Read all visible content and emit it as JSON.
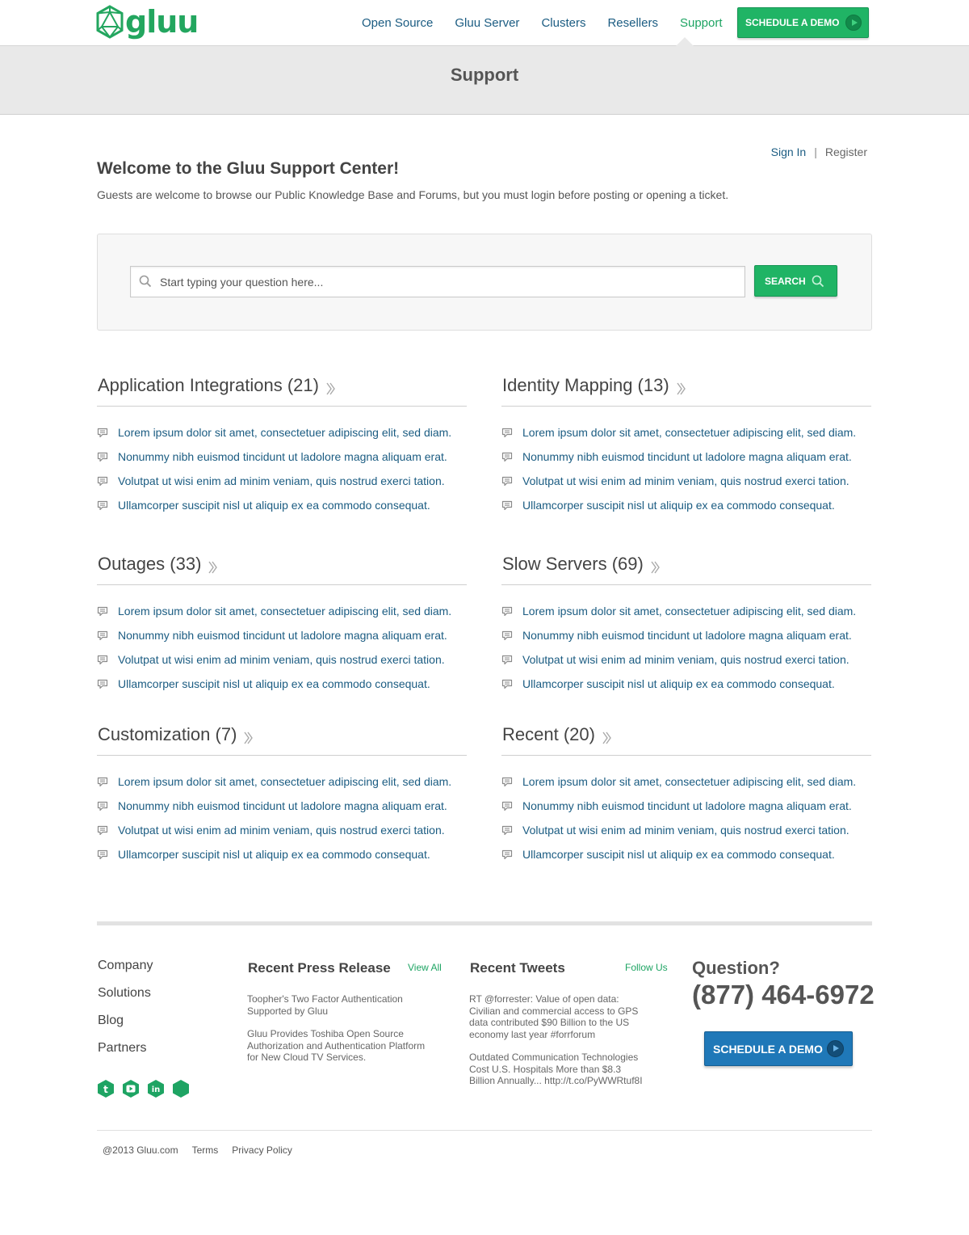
{
  "brand": {
    "name": "gluu",
    "color": "#23a65f",
    "icon": "gluu-logo-icon"
  },
  "nav": {
    "items": [
      "Open Source",
      "Gluu Server",
      "Clusters",
      "Resellers",
      "Support"
    ],
    "active": "Support",
    "demo_label": "SCHEDULE A DEMO",
    "demo_icon": "play-arrow-icon"
  },
  "page": {
    "title": "Support"
  },
  "auth": {
    "signin": "Sign In",
    "separator": "|",
    "register": "Register"
  },
  "welcome": {
    "title": "Welcome to the Gluu Support Center!",
    "subtitle": "Guests are welcome to browse our Public Knowledge Base and Forums, but you must login before posting or opening a ticket."
  },
  "search": {
    "placeholder": "Start typing your question here...",
    "button": "SEARCH",
    "icon": "search-icon"
  },
  "categories": [
    {
      "title": "Application Integrations (21)",
      "items": [
        "Lorem ipsum dolor sit amet, consectetuer adipiscing elit, sed diam.",
        "Nonummy nibh euismod tincidunt ut ladolore magna aliquam erat.",
        "Volutpat ut wisi enim ad minim veniam, quis nostrud exerci tation.",
        "Ullamcorper suscipit nisl ut aliquip ex ea commodo consequat."
      ]
    },
    {
      "title": "Identity Mapping (13)",
      "items": [
        "Lorem ipsum dolor sit amet, consectetuer adipiscing elit, sed diam.",
        "Nonummy nibh euismod tincidunt ut ladolore magna aliquam erat.",
        "Volutpat ut wisi enim ad minim veniam, quis nostrud exerci tation.",
        "Ullamcorper suscipit nisl ut aliquip ex ea commodo consequat."
      ]
    },
    {
      "title": "Outages (33)",
      "items": [
        "Lorem ipsum dolor sit amet, consectetuer adipiscing elit, sed diam.",
        "Nonummy nibh euismod tincidunt ut ladolore magna aliquam erat.",
        "Volutpat ut wisi enim ad minim veniam, quis nostrud exerci tation.",
        "Ullamcorper suscipit nisl ut aliquip ex ea commodo consequat."
      ]
    },
    {
      "title": "Slow Servers (69)",
      "items": [
        "Lorem ipsum dolor sit amet, consectetuer adipiscing elit, sed diam.",
        "Nonummy nibh euismod tincidunt ut ladolore magna aliquam erat.",
        "Volutpat ut wisi enim ad minim veniam, quis nostrud exerci tation.",
        "Ullamcorper suscipit nisl ut aliquip ex ea commodo consequat."
      ]
    },
    {
      "title": "Customization (7)",
      "items": [
        "Lorem ipsum dolor sit amet, consectetuer adipiscing elit, sed diam.",
        "Nonummy nibh euismod tincidunt ut ladolore magna aliquam erat.",
        "Volutpat ut wisi enim ad minim veniam, quis nostrud exerci tation.",
        "Ullamcorper suscipit nisl ut aliquip ex ea commodo consequat."
      ]
    },
    {
      "title": "Recent (20)",
      "items": [
        "Lorem ipsum dolor sit amet, consectetuer adipiscing elit, sed diam.",
        "Nonummy nibh euismod tincidunt ut ladolore magna aliquam erat.",
        "Volutpat ut wisi enim ad minim veniam, quis nostrud exerci tation.",
        "Ullamcorper suscipit nisl ut aliquip ex ea commodo consequat."
      ]
    }
  ],
  "footer": {
    "links": [
      "Company",
      "Solutions",
      "Blog",
      "Partners"
    ],
    "social_icons": [
      "twitter-icon",
      "youtube-icon",
      "linkedin-icon",
      "hexagon-icon"
    ],
    "press": {
      "title": "Recent Press Release",
      "link": "View All",
      "items": [
        "Toopher's Two Factor Authentication Supported by Gluu",
        "Gluu Provides Toshiba Open Source Authorization and Authentication Platform for New Cloud TV Services."
      ]
    },
    "tweets": {
      "title": "Recent Tweets",
      "link": "Follow Us",
      "items": [
        "RT @forrester: Value of open data: Civilian and commercial access to GPS data contributed $90 Billion to the US economy last year #forrforum",
        "Outdated Communication Technologies Cost U.S. Hospitals More than $8.3 Billion Annually... http://t.co/PyWWRtuf8I"
      ]
    },
    "question": "Question?",
    "phone": "(877) 464-6972",
    "demo_label": "SCHEDULE A DEMO",
    "copyright": "@2013 Gluu.com",
    "terms": "Terms",
    "privacy": "Privacy Policy"
  },
  "colors": {
    "accent_green": "#20b465",
    "link_blue": "#1b5c82",
    "button_blue": "#1f78b8"
  }
}
